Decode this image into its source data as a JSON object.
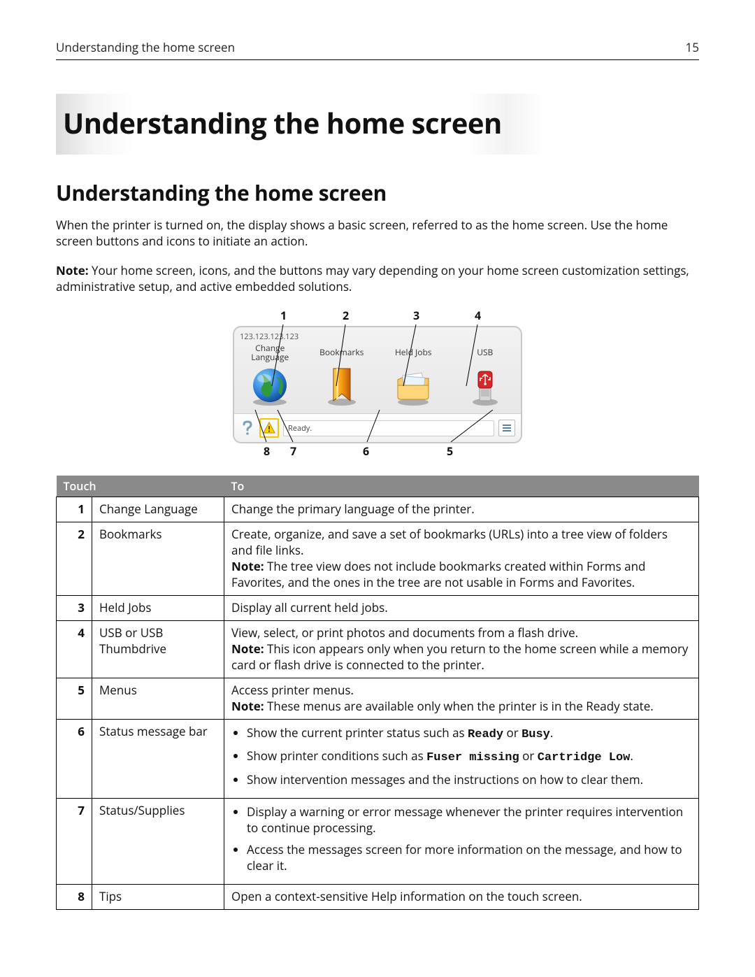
{
  "header": {
    "running_title": "Understanding the home screen",
    "page_number": "15"
  },
  "chapter_title": "Understanding the home screen",
  "section_title": "Understanding the home screen",
  "intro_paragraph": "When the printer is turned on, the display shows a basic screen, referred to as the home screen. Use the home screen buttons and icons to initiate an action.",
  "note_paragraph": {
    "lead": "Note:",
    "text": " Your home screen, icons, and the buttons may vary depending on your home screen customization settings, administrative setup, and active embedded solutions."
  },
  "figure": {
    "top_callouts": [
      "1",
      "2",
      "3",
      "4"
    ],
    "bottom_callouts": [
      "8",
      "7",
      "6",
      "5"
    ],
    "ip_address": "123.123.123.123",
    "icons": {
      "change_language": "Change Language",
      "bookmarks": "Bookmarks",
      "held_jobs": "Held Jobs",
      "usb": "USB"
    },
    "status_text": "Ready."
  },
  "table": {
    "header_touch": "Touch",
    "header_to": "To",
    "rows": [
      {
        "num": "1",
        "touch": "Change Language",
        "to_html": "Change the primary language of the printer."
      },
      {
        "num": "2",
        "touch": "Bookmarks",
        "to_html": "Create, organize, and save a set of bookmarks (URLs) into a tree view of folders and file links.",
        "note_lead": "Note:",
        "note_text": " The tree view does not include bookmarks created within Forms and Favorites, and the ones in the tree are not usable in Forms and Favorites."
      },
      {
        "num": "3",
        "touch": "Held Jobs",
        "to_html": "Display all current held jobs."
      },
      {
        "num": "4",
        "touch": "USB or USB Thumbdrive",
        "to_html": "View, select, or print photos and documents from a flash drive.",
        "note_lead": "Note:",
        "note_text": " This icon appears only when you return to the home screen while a memory card or flash drive is connected to the printer."
      },
      {
        "num": "5",
        "touch": "Menus",
        "to_html": "Access printer menus.",
        "note_lead": "Note:",
        "note_text": " These menus are available only when the printer is in the Ready state."
      },
      {
        "num": "6",
        "touch": "Status message bar",
        "bullets": [
          {
            "pre": "Show the current printer status such as ",
            "mono1": "Ready",
            "mid": " or ",
            "mono2": "Busy",
            "post": "."
          },
          {
            "pre": "Show printer conditions such as ",
            "mono1": "Fuser missing",
            "mid": " or ",
            "mono2": "Cartridge Low",
            "post": "."
          },
          {
            "pre": "Show intervention messages and the instructions on how to clear them.",
            "mono1": "",
            "mid": "",
            "mono2": "",
            "post": ""
          }
        ]
      },
      {
        "num": "7",
        "touch": "Status/Supplies",
        "bullets_plain": [
          "Display a warning or error message whenever the printer requires intervention to continue processing.",
          "Access the messages screen for more information on the message, and how to clear it."
        ]
      },
      {
        "num": "8",
        "touch": "Tips",
        "to_html": "Open a context-sensitive Help information on the touch screen."
      }
    ]
  }
}
